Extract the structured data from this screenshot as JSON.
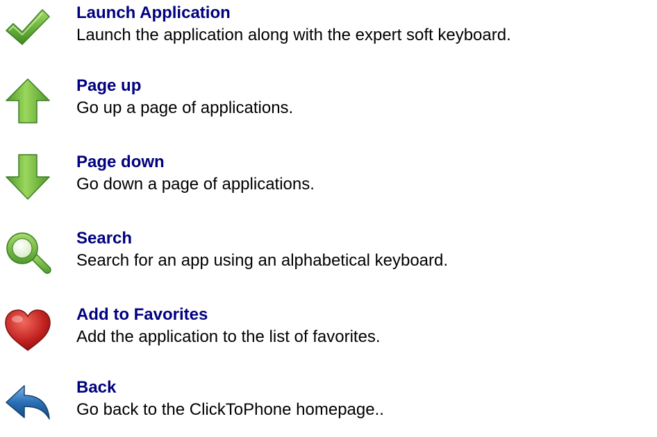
{
  "items": [
    {
      "icon": "checkmark-icon",
      "title": "Launch Application",
      "description": "Launch the application along with the expert soft keyboard."
    },
    {
      "icon": "arrow-up-icon",
      "title": "Page up",
      "description": "Go up a page of applications."
    },
    {
      "icon": "arrow-down-icon",
      "title": "Page down",
      "description": "Go down a page of applications."
    },
    {
      "icon": "magnifier-icon",
      "title": "Search",
      "description": "Search for an app using an alphabetical keyboard."
    },
    {
      "icon": "heart-icon",
      "title": "Add to Favorites",
      "description": "Add the application to the list of favorites."
    },
    {
      "icon": "back-arrow-icon",
      "title": "Back",
      "description": "Go back to the ClickToPhone homepage.."
    }
  ],
  "colors": {
    "title": "#000080",
    "description": "#000000",
    "green": "#6cb33f",
    "red": "#c0201f",
    "blue": "#2a6fb5"
  }
}
